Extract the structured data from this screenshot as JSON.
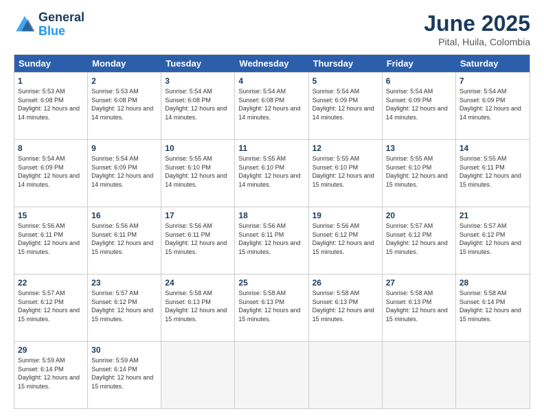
{
  "logo": {
    "text_general": "General",
    "text_blue": "Blue"
  },
  "calendar": {
    "title": "June 2025",
    "subtitle": "Pital, Huila, Colombia",
    "headers": [
      "Sunday",
      "Monday",
      "Tuesday",
      "Wednesday",
      "Thursday",
      "Friday",
      "Saturday"
    ],
    "rows": [
      [
        {
          "day": "1",
          "sunrise": "5:53 AM",
          "sunset": "6:08 PM",
          "daylight": "12 hours and 14 minutes."
        },
        {
          "day": "2",
          "sunrise": "5:53 AM",
          "sunset": "6:08 PM",
          "daylight": "12 hours and 14 minutes."
        },
        {
          "day": "3",
          "sunrise": "5:54 AM",
          "sunset": "6:08 PM",
          "daylight": "12 hours and 14 minutes."
        },
        {
          "day": "4",
          "sunrise": "5:54 AM",
          "sunset": "6:08 PM",
          "daylight": "12 hours and 14 minutes."
        },
        {
          "day": "5",
          "sunrise": "5:54 AM",
          "sunset": "6:09 PM",
          "daylight": "12 hours and 14 minutes."
        },
        {
          "day": "6",
          "sunrise": "5:54 AM",
          "sunset": "6:09 PM",
          "daylight": "12 hours and 14 minutes."
        },
        {
          "day": "7",
          "sunrise": "5:54 AM",
          "sunset": "6:09 PM",
          "daylight": "12 hours and 14 minutes."
        }
      ],
      [
        {
          "day": "8",
          "sunrise": "5:54 AM",
          "sunset": "6:09 PM",
          "daylight": "12 hours and 14 minutes."
        },
        {
          "day": "9",
          "sunrise": "5:54 AM",
          "sunset": "6:09 PM",
          "daylight": "12 hours and 14 minutes."
        },
        {
          "day": "10",
          "sunrise": "5:55 AM",
          "sunset": "6:10 PM",
          "daylight": "12 hours and 14 minutes."
        },
        {
          "day": "11",
          "sunrise": "5:55 AM",
          "sunset": "6:10 PM",
          "daylight": "12 hours and 14 minutes."
        },
        {
          "day": "12",
          "sunrise": "5:55 AM",
          "sunset": "6:10 PM",
          "daylight": "12 hours and 15 minutes."
        },
        {
          "day": "13",
          "sunrise": "5:55 AM",
          "sunset": "6:10 PM",
          "daylight": "12 hours and 15 minutes."
        },
        {
          "day": "14",
          "sunrise": "5:55 AM",
          "sunset": "6:11 PM",
          "daylight": "12 hours and 15 minutes."
        }
      ],
      [
        {
          "day": "15",
          "sunrise": "5:56 AM",
          "sunset": "6:11 PM",
          "daylight": "12 hours and 15 minutes."
        },
        {
          "day": "16",
          "sunrise": "5:56 AM",
          "sunset": "6:11 PM",
          "daylight": "12 hours and 15 minutes."
        },
        {
          "day": "17",
          "sunrise": "5:56 AM",
          "sunset": "6:11 PM",
          "daylight": "12 hours and 15 minutes."
        },
        {
          "day": "18",
          "sunrise": "5:56 AM",
          "sunset": "6:11 PM",
          "daylight": "12 hours and 15 minutes."
        },
        {
          "day": "19",
          "sunrise": "5:56 AM",
          "sunset": "6:12 PM",
          "daylight": "12 hours and 15 minutes."
        },
        {
          "day": "20",
          "sunrise": "5:57 AM",
          "sunset": "6:12 PM",
          "daylight": "12 hours and 15 minutes."
        },
        {
          "day": "21",
          "sunrise": "5:57 AM",
          "sunset": "6:12 PM",
          "daylight": "12 hours and 15 minutes."
        }
      ],
      [
        {
          "day": "22",
          "sunrise": "5:57 AM",
          "sunset": "6:12 PM",
          "daylight": "12 hours and 15 minutes."
        },
        {
          "day": "23",
          "sunrise": "5:57 AM",
          "sunset": "6:12 PM",
          "daylight": "12 hours and 15 minutes."
        },
        {
          "day": "24",
          "sunrise": "5:58 AM",
          "sunset": "6:13 PM",
          "daylight": "12 hours and 15 minutes."
        },
        {
          "day": "25",
          "sunrise": "5:58 AM",
          "sunset": "6:13 PM",
          "daylight": "12 hours and 15 minutes."
        },
        {
          "day": "26",
          "sunrise": "5:58 AM",
          "sunset": "6:13 PM",
          "daylight": "12 hours and 15 minutes."
        },
        {
          "day": "27",
          "sunrise": "5:58 AM",
          "sunset": "6:13 PM",
          "daylight": "12 hours and 15 minutes."
        },
        {
          "day": "28",
          "sunrise": "5:58 AM",
          "sunset": "6:14 PM",
          "daylight": "12 hours and 15 minutes."
        }
      ],
      [
        {
          "day": "29",
          "sunrise": "5:59 AM",
          "sunset": "6:14 PM",
          "daylight": "12 hours and 15 minutes."
        },
        {
          "day": "30",
          "sunrise": "5:59 AM",
          "sunset": "6:14 PM",
          "daylight": "12 hours and 15 minutes."
        },
        null,
        null,
        null,
        null,
        null
      ]
    ]
  },
  "labels": {
    "sunrise": "Sunrise:",
    "sunset": "Sunset:",
    "daylight": "Daylight:"
  }
}
